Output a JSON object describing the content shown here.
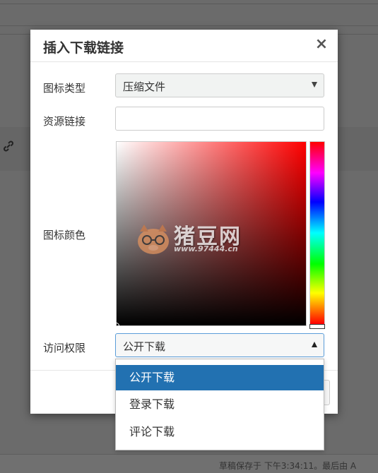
{
  "dialog": {
    "title": "插入下载链接",
    "close_label": "×",
    "icon_type": {
      "label": "图标类型",
      "value": "压缩文件"
    },
    "resource_link": {
      "label": "资源链接",
      "value": ""
    },
    "icon_color": {
      "label": "图标颜色",
      "selected_color": "#000000",
      "hue": "#ff0000"
    },
    "access": {
      "label": "访问权限",
      "value": "公开下载",
      "options": [
        "公开下载",
        "登录下载",
        "评论下载"
      ],
      "selected_index": 0
    }
  },
  "watermark": {
    "text": "猪豆网",
    "sub": "www.97444.cn"
  },
  "background": {
    "status_text": "草稿保存于 下午3:34:11。最后由 A"
  },
  "colors": {
    "accent": "#2271b1",
    "focus_border": "#5b9dd9"
  }
}
